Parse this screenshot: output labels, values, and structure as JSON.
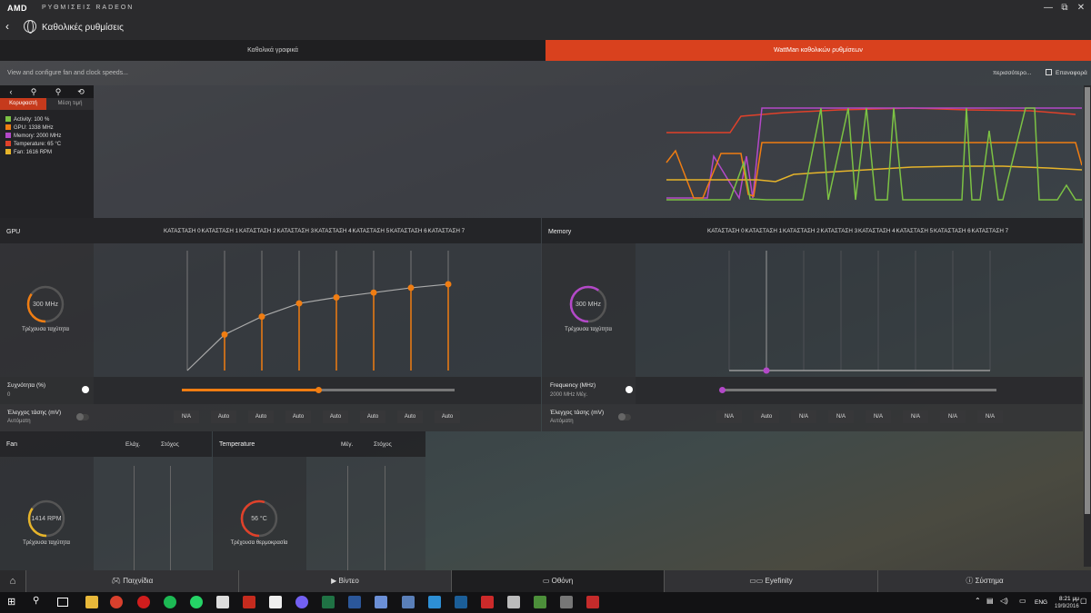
{
  "window": {
    "logo": "AMD",
    "app_name": "ΡΥΘΜΙΣΕΙΣ RADEON",
    "minimize": "—",
    "maximize": "⧉",
    "close": "✕"
  },
  "nav": {
    "back": "‹",
    "title": "Καθολικές ρυθμίσεις"
  },
  "tabs": [
    {
      "label": "Καθολικά γραφικά",
      "active": false
    },
    {
      "label": "WattMan καθολικών ρυθμίσεων",
      "active": true
    }
  ],
  "subheader": {
    "description": "View and configure fan and clock speeds...",
    "more_link": "περισσότερο...",
    "reset_label": "Επαναφορά"
  },
  "monitor": {
    "toolbar": [
      "‹",
      "⚲",
      "⚲",
      "⟲"
    ],
    "peak_label": "Κορυφαστή",
    "avg_label": "Μέση τιμή",
    "legend": [
      {
        "label": "Activity: 100 %",
        "color": "#7cc244"
      },
      {
        "label": "GPU: 1338 MHz",
        "color": "#f07d12"
      },
      {
        "label": "Memory: 2000 MHz",
        "color": "#b348c8"
      },
      {
        "label": "Temperature: 65 °C",
        "color": "#e0412a"
      },
      {
        "label": "Fan: 1616 RPM",
        "color": "#e6b42a"
      }
    ]
  },
  "gpu": {
    "title": "GPU",
    "states": [
      "ΚΑΤΑΣΤΑΣΗ 0",
      "ΚΑΤΑΣΤΑΣΗ 1",
      "ΚΑΤΑΣΤΑΣΗ 2",
      "ΚΑΤΑΣΤΑΣΗ 3",
      "ΚΑΤΑΣΤΑΣΗ 4",
      "ΚΑΤΑΣΤΑΣΗ 5",
      "ΚΑΤΑΣΤΑΣΗ 6",
      "ΚΑΤΑΣΤΑΣΗ 7"
    ],
    "gauge_value": "300 MHz",
    "gauge_label": "Τρέχουσα ταχύτητα",
    "gauge_fraction": 0.35,
    "accent": "#f07d12",
    "curve_levels": [
      0.3,
      0.45,
      0.56,
      0.61,
      0.65,
      0.69,
      0.72
    ],
    "frequency_label": "Συχνότητα (%)",
    "frequency_value": "0",
    "frequency_slider": 0.5,
    "voltage_label": "Έλεγχος τάσης (mV)",
    "voltage_value": "Αυτόματη",
    "voltage_values": [
      "N/A",
      "Auto",
      "Auto",
      "Auto",
      "Auto",
      "Auto",
      "Auto",
      "Auto"
    ]
  },
  "memory": {
    "title": "Memory",
    "states": [
      "ΚΑΤΑΣΤΑΣΗ 0",
      "ΚΑΤΑΣΤΑΣΗ 1",
      "ΚΑΤΑΣΤΑΣΗ 2",
      "ΚΑΤΑΣΤΑΣΗ 3",
      "ΚΑΤΑΣΤΑΣΗ 4",
      "ΚΑΤΑΣΤΑΣΗ 5",
      "ΚΑΤΑΣΤΑΣΗ 6",
      "ΚΑΤΑΣΤΑΣΗ 7"
    ],
    "gauge_value": "300 MHz",
    "gauge_label": "Τρέχουσα ταχύτητα",
    "gauge_fraction": 0.6,
    "accent": "#b348c8",
    "frequency_label": "Frequency (MHz)",
    "frequency_value": "2000 MHz Μέγ.",
    "voltage_label": "Έλεγχος τάσης (mV)",
    "voltage_value": "Αυτόματη",
    "voltage_values": [
      "N/A",
      "Auto",
      "N/A",
      "N/A",
      "N/A",
      "N/A",
      "N/A",
      "N/A"
    ]
  },
  "fan": {
    "title": "Fan",
    "col_min": "Ελάχ.",
    "col_target": "Στόχος",
    "gauge_value": "1414 RPM",
    "gauge_label": "Τρέχουσα ταχύτητα",
    "gauge_fraction": 0.35,
    "accent": "#e6b42a"
  },
  "temperature": {
    "title": "Temperature",
    "col_max": "Μέγ.",
    "col_target": "Στόχος",
    "gauge_value": "56 °C",
    "gauge_label": "Τρέχουσα θερμοκρασία",
    "gauge_fraction": 0.55,
    "accent": "#e0412a"
  },
  "bottom_nav": [
    {
      "label": "Παιχνίδια",
      "icon": "gamepad-icon"
    },
    {
      "label": "Βίντεο",
      "icon": "play-icon"
    },
    {
      "label": "Οθόνη",
      "icon": "monitor-icon"
    },
    {
      "label": "Eyefinity",
      "icon": "eyefinity-icon"
    },
    {
      "label": "Σύστημα",
      "icon": "info-icon"
    }
  ],
  "taskbar": {
    "lang": "ENG",
    "time": "8:21 μμ",
    "date": "19/9/2016"
  }
}
